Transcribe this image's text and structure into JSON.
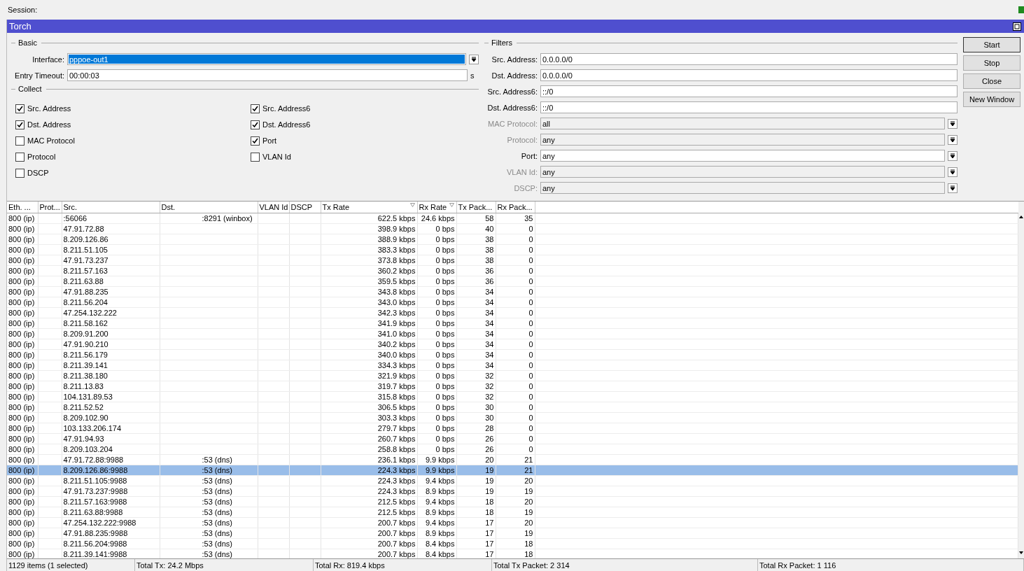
{
  "session": {
    "label": "Session:"
  },
  "window": {
    "title": "Torch"
  },
  "basic": {
    "legend": "Basic",
    "interface": {
      "label": "Interface:",
      "value": "pppoe-out1"
    },
    "entry_timeout": {
      "label": "Entry Timeout:",
      "value": "00:00:03",
      "unit": "s"
    }
  },
  "collect": {
    "legend": "Collect",
    "items": [
      {
        "label": "Src. Address",
        "checked": true
      },
      {
        "label": "Src. Address6",
        "checked": true
      },
      {
        "label": "Dst. Address",
        "checked": true
      },
      {
        "label": "Dst. Address6",
        "checked": true
      },
      {
        "label": "MAC Protocol",
        "checked": false
      },
      {
        "label": "Port",
        "checked": true
      },
      {
        "label": "Protocol",
        "checked": false
      },
      {
        "label": "VLAN Id",
        "checked": false
      },
      {
        "label": "DSCP",
        "checked": false
      }
    ]
  },
  "filters": {
    "legend": "Filters",
    "items": [
      {
        "kind": "text",
        "label": "Src. Address:",
        "value": "0.0.0.0/0",
        "disabled": false
      },
      {
        "kind": "text",
        "label": "Dst. Address:",
        "value": "0.0.0.0/0",
        "disabled": false
      },
      {
        "kind": "text",
        "label": "Src. Address6:",
        "value": "::/0",
        "disabled": false
      },
      {
        "kind": "text",
        "label": "Dst. Address6:",
        "value": "::/0",
        "disabled": false
      },
      {
        "kind": "select",
        "label": "MAC Protocol:",
        "value": "all",
        "disabled": true
      },
      {
        "kind": "select",
        "label": "Protocol:",
        "value": "any",
        "disabled": true
      },
      {
        "kind": "select",
        "label": "Port:",
        "value": "any",
        "disabled": false
      },
      {
        "kind": "select",
        "label": "VLAN Id:",
        "value": "any",
        "disabled": true
      },
      {
        "kind": "select",
        "label": "DSCP:",
        "value": "any",
        "disabled": true
      }
    ]
  },
  "buttons": [
    {
      "label": "Start",
      "default": true
    },
    {
      "label": "Stop",
      "default": false
    },
    {
      "label": "Close",
      "default": false
    },
    {
      "label": "New Window",
      "default": false
    }
  ],
  "table": {
    "columns": [
      {
        "label": "Eth. ...",
        "sorted": false
      },
      {
        "label": "Prot...",
        "sorted": false
      },
      {
        "label": "Src.",
        "sorted": false
      },
      {
        "label": "Dst.",
        "sorted": false
      },
      {
        "label": "VLAN Id",
        "sorted": false
      },
      {
        "label": "DSCP",
        "sorted": false
      },
      {
        "label": "Tx Rate",
        "sorted": true
      },
      {
        "label": "Rx Rate",
        "sorted": true
      },
      {
        "label": "Tx Pack...",
        "sorted": false
      },
      {
        "label": "Rx Pack...",
        "sorted": false
      }
    ],
    "rows": [
      {
        "eth": "800 (ip)",
        "src": ":56066",
        "dst": ":8291 (winbox)",
        "tx": "622.5 kbps",
        "rx": "24.6 kbps",
        "txp": "58",
        "rxp": "35",
        "selected": false
      },
      {
        "eth": "800 (ip)",
        "src": "47.91.72.88",
        "dst": "",
        "tx": "398.9 kbps",
        "rx": "0 bps",
        "txp": "40",
        "rxp": "0",
        "selected": false
      },
      {
        "eth": "800 (ip)",
        "src": "8.209.126.86",
        "dst": "",
        "tx": "388.9 kbps",
        "rx": "0 bps",
        "txp": "38",
        "rxp": "0",
        "selected": false
      },
      {
        "eth": "800 (ip)",
        "src": "8.211.51.105",
        "dst": "",
        "tx": "383.3 kbps",
        "rx": "0 bps",
        "txp": "38",
        "rxp": "0",
        "selected": false
      },
      {
        "eth": "800 (ip)",
        "src": "47.91.73.237",
        "dst": "",
        "tx": "373.8 kbps",
        "rx": "0 bps",
        "txp": "38",
        "rxp": "0",
        "selected": false
      },
      {
        "eth": "800 (ip)",
        "src": "8.211.57.163",
        "dst": "",
        "tx": "360.2 kbps",
        "rx": "0 bps",
        "txp": "36",
        "rxp": "0",
        "selected": false
      },
      {
        "eth": "800 (ip)",
        "src": "8.211.63.88",
        "dst": "",
        "tx": "359.5 kbps",
        "rx": "0 bps",
        "txp": "36",
        "rxp": "0",
        "selected": false
      },
      {
        "eth": "800 (ip)",
        "src": "47.91.88.235",
        "dst": "",
        "tx": "343.8 kbps",
        "rx": "0 bps",
        "txp": "34",
        "rxp": "0",
        "selected": false
      },
      {
        "eth": "800 (ip)",
        "src": "8.211.56.204",
        "dst": "",
        "tx": "343.0 kbps",
        "rx": "0 bps",
        "txp": "34",
        "rxp": "0",
        "selected": false
      },
      {
        "eth": "800 (ip)",
        "src": "47.254.132.222",
        "dst": "",
        "tx": "342.3 kbps",
        "rx": "0 bps",
        "txp": "34",
        "rxp": "0",
        "selected": false
      },
      {
        "eth": "800 (ip)",
        "src": "8.211.58.162",
        "dst": "",
        "tx": "341.9 kbps",
        "rx": "0 bps",
        "txp": "34",
        "rxp": "0",
        "selected": false
      },
      {
        "eth": "800 (ip)",
        "src": "8.209.91.200",
        "dst": "",
        "tx": "341.0 kbps",
        "rx": "0 bps",
        "txp": "34",
        "rxp": "0",
        "selected": false
      },
      {
        "eth": "800 (ip)",
        "src": "47.91.90.210",
        "dst": "",
        "tx": "340.2 kbps",
        "rx": "0 bps",
        "txp": "34",
        "rxp": "0",
        "selected": false
      },
      {
        "eth": "800 (ip)",
        "src": "8.211.56.179",
        "dst": "",
        "tx": "340.0 kbps",
        "rx": "0 bps",
        "txp": "34",
        "rxp": "0",
        "selected": false
      },
      {
        "eth": "800 (ip)",
        "src": "8.211.39.141",
        "dst": "",
        "tx": "334.3 kbps",
        "rx": "0 bps",
        "txp": "34",
        "rxp": "0",
        "selected": false
      },
      {
        "eth": "800 (ip)",
        "src": "8.211.38.180",
        "dst": "",
        "tx": "321.9 kbps",
        "rx": "0 bps",
        "txp": "32",
        "rxp": "0",
        "selected": false
      },
      {
        "eth": "800 (ip)",
        "src": "8.211.13.83",
        "dst": "",
        "tx": "319.7 kbps",
        "rx": "0 bps",
        "txp": "32",
        "rxp": "0",
        "selected": false
      },
      {
        "eth": "800 (ip)",
        "src": "104.131.89.53",
        "dst": "",
        "tx": "315.8 kbps",
        "rx": "0 bps",
        "txp": "32",
        "rxp": "0",
        "selected": false
      },
      {
        "eth": "800 (ip)",
        "src": "8.211.52.52",
        "dst": "",
        "tx": "306.5 kbps",
        "rx": "0 bps",
        "txp": "30",
        "rxp": "0",
        "selected": false
      },
      {
        "eth": "800 (ip)",
        "src": "8.209.102.90",
        "dst": "",
        "tx": "303.3 kbps",
        "rx": "0 bps",
        "txp": "30",
        "rxp": "0",
        "selected": false
      },
      {
        "eth": "800 (ip)",
        "src": "103.133.206.174",
        "dst": "",
        "tx": "279.7 kbps",
        "rx": "0 bps",
        "txp": "28",
        "rxp": "0",
        "selected": false
      },
      {
        "eth": "800 (ip)",
        "src": "47.91.94.93",
        "dst": "",
        "tx": "260.7 kbps",
        "rx": "0 bps",
        "txp": "26",
        "rxp": "0",
        "selected": false
      },
      {
        "eth": "800 (ip)",
        "src": "8.209.103.204",
        "dst": "",
        "tx": "258.8 kbps",
        "rx": "0 bps",
        "txp": "26",
        "rxp": "0",
        "selected": false
      },
      {
        "eth": "800 (ip)",
        "src": "47.91.72.88:9988",
        "dst": ":53 (dns)",
        "tx": "236.1 kbps",
        "rx": "9.9 kbps",
        "txp": "20",
        "rxp": "21",
        "selected": false
      },
      {
        "eth": "800 (ip)",
        "src": "8.209.126.86:9988",
        "dst": ":53 (dns)",
        "tx": "224.3 kbps",
        "rx": "9.9 kbps",
        "txp": "19",
        "rxp": "21",
        "selected": true
      },
      {
        "eth": "800 (ip)",
        "src": "8.211.51.105:9988",
        "dst": ":53 (dns)",
        "tx": "224.3 kbps",
        "rx": "9.4 kbps",
        "txp": "19",
        "rxp": "20",
        "selected": false
      },
      {
        "eth": "800 (ip)",
        "src": "47.91.73.237:9988",
        "dst": ":53 (dns)",
        "tx": "224.3 kbps",
        "rx": "8.9 kbps",
        "txp": "19",
        "rxp": "19",
        "selected": false
      },
      {
        "eth": "800 (ip)",
        "src": "8.211.57.163:9988",
        "dst": ":53 (dns)",
        "tx": "212.5 kbps",
        "rx": "9.4 kbps",
        "txp": "18",
        "rxp": "20",
        "selected": false
      },
      {
        "eth": "800 (ip)",
        "src": "8.211.63.88:9988",
        "dst": ":53 (dns)",
        "tx": "212.5 kbps",
        "rx": "8.9 kbps",
        "txp": "18",
        "rxp": "19",
        "selected": false
      },
      {
        "eth": "800 (ip)",
        "src": "47.254.132.222:9988",
        "dst": ":53 (dns)",
        "tx": "200.7 kbps",
        "rx": "9.4 kbps",
        "txp": "17",
        "rxp": "20",
        "selected": false
      },
      {
        "eth": "800 (ip)",
        "src": "47.91.88.235:9988",
        "dst": ":53 (dns)",
        "tx": "200.7 kbps",
        "rx": "8.9 kbps",
        "txp": "17",
        "rxp": "19",
        "selected": false
      },
      {
        "eth": "800 (ip)",
        "src": "8.211.56.204:9988",
        "dst": ":53 (dns)",
        "tx": "200.7 kbps",
        "rx": "8.4 kbps",
        "txp": "17",
        "rxp": "18",
        "selected": false
      },
      {
        "eth": "800 (ip)",
        "src": "8.211.39.141:9988",
        "dst": ":53 (dns)",
        "tx": "200.7 kbps",
        "rx": "8.4 kbps",
        "txp": "17",
        "rxp": "18",
        "selected": false
      }
    ]
  },
  "status_bar": [
    "1129 items (1 selected)",
    "Total Tx: 24.2 Mbps",
    "Total Rx: 819.4 kbps",
    "Total Tx Packet: 2 314",
    "Total Rx Packet: 1 116"
  ]
}
